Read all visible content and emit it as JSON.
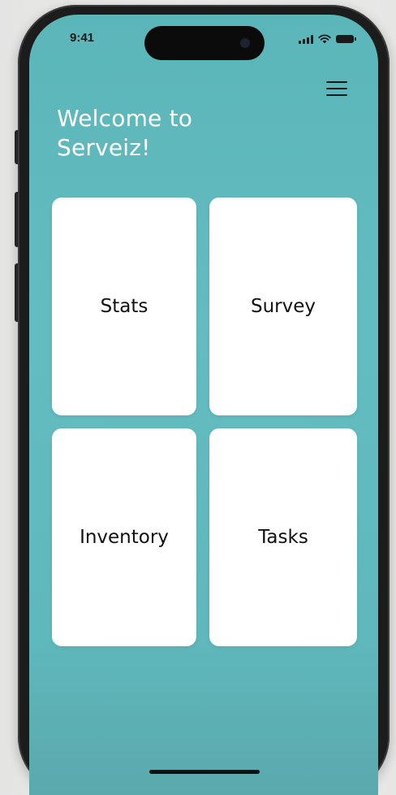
{
  "status_bar": {
    "time": "9:41",
    "icons": [
      "signal-icon",
      "wifi-icon",
      "battery-icon"
    ]
  },
  "header": {
    "menu_icon": "hamburger-menu-icon",
    "welcome_text": "Welcome to Serveiz!"
  },
  "cards": [
    {
      "label": "Stats"
    },
    {
      "label": "Survey"
    },
    {
      "label": "Inventory"
    },
    {
      "label": "Tasks"
    }
  ],
  "colors": {
    "background": "#5fb8bc",
    "card": "#ffffff",
    "text_dark": "#111111",
    "text_light": "#ffffff"
  }
}
